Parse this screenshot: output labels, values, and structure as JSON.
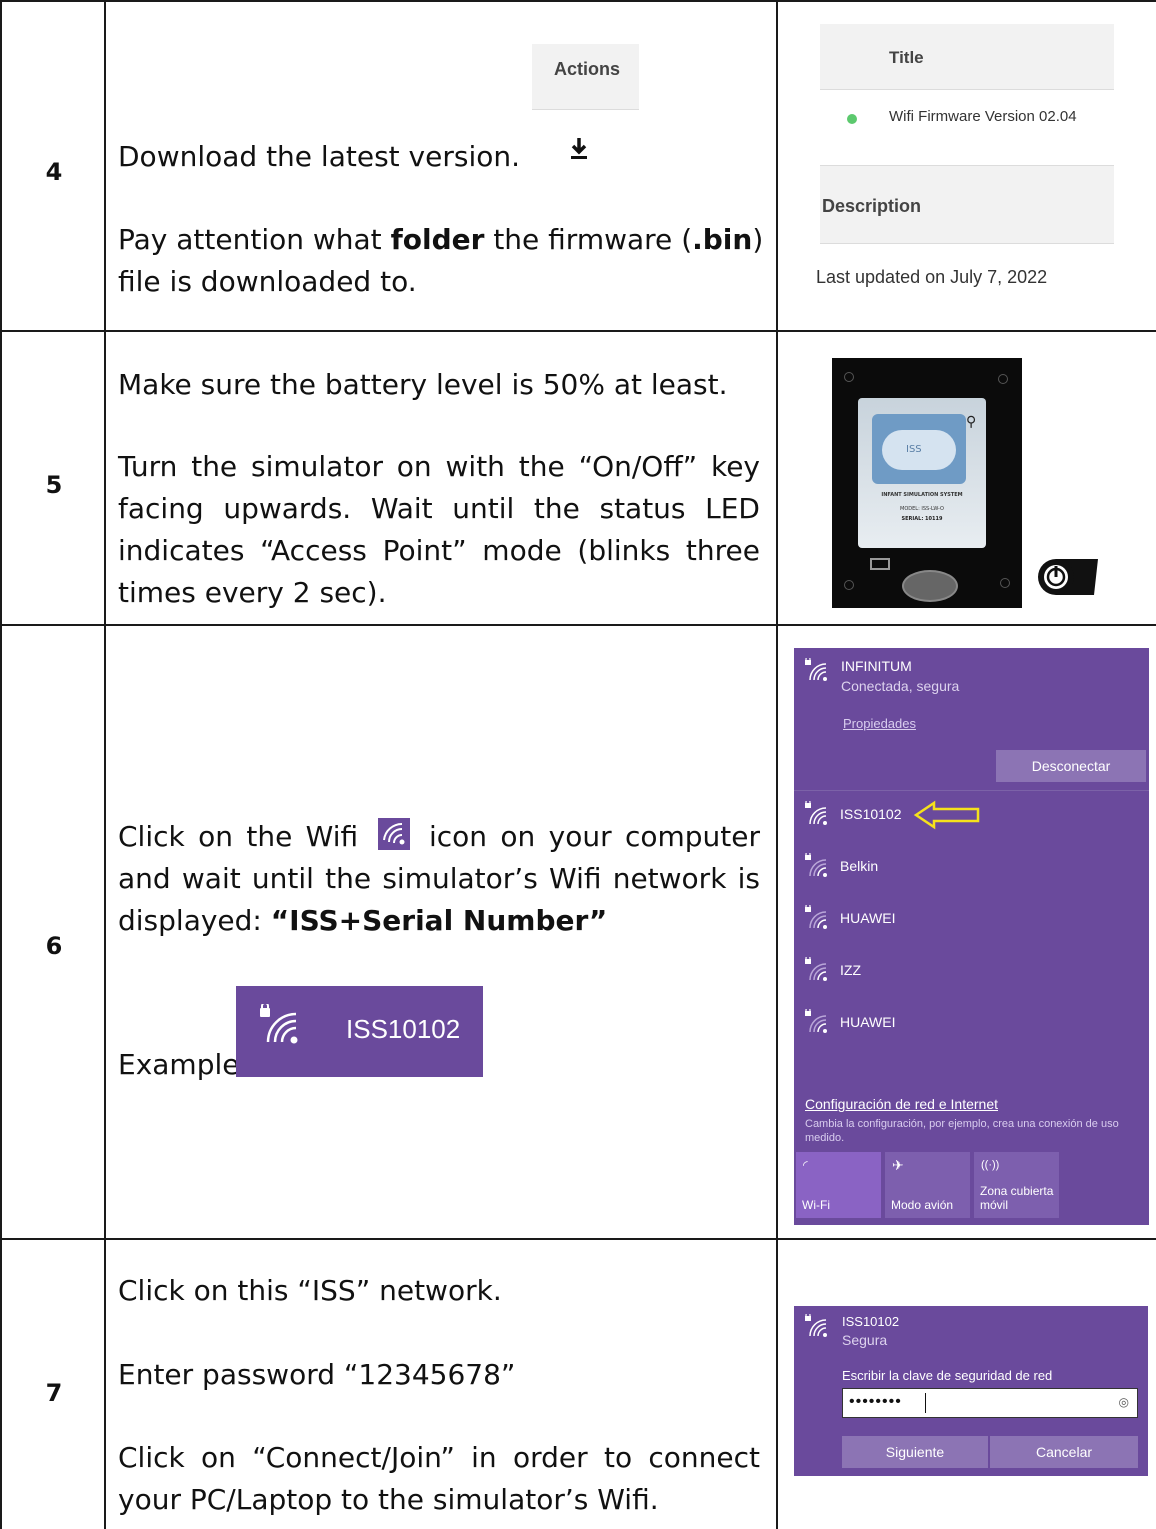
{
  "rows": [
    {
      "number": "4",
      "text": {
        "line1": "Download the latest version.",
        "line2_a": "Pay attention what ",
        "line2_bold1": "folder",
        "line2_b": " the firmware (",
        "line2_bold2": ".bin",
        "line2_c": ")",
        "line3": "file is downloaded to."
      },
      "actions_header": "Actions",
      "download_icon": "download-icon",
      "firmware_panel": {
        "title_header": "Title",
        "firmware_name": "Wifi Firmware Version 02.04",
        "status_color": "#5cc96e",
        "description_header": "Description",
        "last_updated": "Last updated on July 7, 2022"
      }
    },
    {
      "number": "5",
      "text": {
        "para1": "Make sure the battery level is 50% at least.",
        "para2": "Turn the simulator on with the “On/Off” key facing upwards. Wait until the status LED indicates “Access Point” mode (blinks three times every 2 sec)."
      },
      "device_label": {
        "line1": "INFANT SIMULATION SYSTEM",
        "line2": "MODEL: ISS-LW-O",
        "line3": "SERIAL: 10119",
        "logo": "ISS"
      }
    },
    {
      "number": "6",
      "text": {
        "part1": "Click on the Wifi",
        "part2": "icon on your computer and wait until the simulator’s Wifi network is displayed:",
        "bold": "“ISS+Serial Number”",
        "example_label": "Example"
      },
      "example_network": "ISS10102",
      "wifi_panel": {
        "connected_name": "INFINITUM",
        "connected_status": "Conectada, segura",
        "properties_link": "Propiedades",
        "disconnect_button": "Desconectar",
        "networks": [
          "ISS10102",
          "Belkin",
          "HUAWEI",
          "IZZ",
          "HUAWEI"
        ],
        "arrow_color": "#f5e11c",
        "settings_link": "Configuración de red e Internet",
        "settings_desc": "Cambia la configuración, por ejemplo, crea una conexión de uso medido.",
        "tiles": [
          {
            "icon": "wifi-icon",
            "label": "Wi-Fi"
          },
          {
            "icon": "airplane-icon",
            "label": "Modo avión"
          },
          {
            "icon": "hotspot-icon",
            "label": "Zona cubierta móvil"
          }
        ]
      }
    },
    {
      "number": "7",
      "text": {
        "para1": "Click on this “ISS” network.",
        "para2": "Enter password “12345678”",
        "para3": "Click on “Connect/Join” in order to connect your PC/Laptop to the simulator’s Wifi."
      },
      "password_panel": {
        "network_name": "ISS10102",
        "status": "Segura",
        "prompt": "Escribir la clave de seguridad de red",
        "password_mask": "••••••••",
        "next_button": "Siguiente",
        "cancel_button": "Cancelar"
      }
    }
  ],
  "colors": {
    "purple": "#6a4a9c",
    "purple_tile": "#7d5fae",
    "border": "#1a1a1a"
  }
}
